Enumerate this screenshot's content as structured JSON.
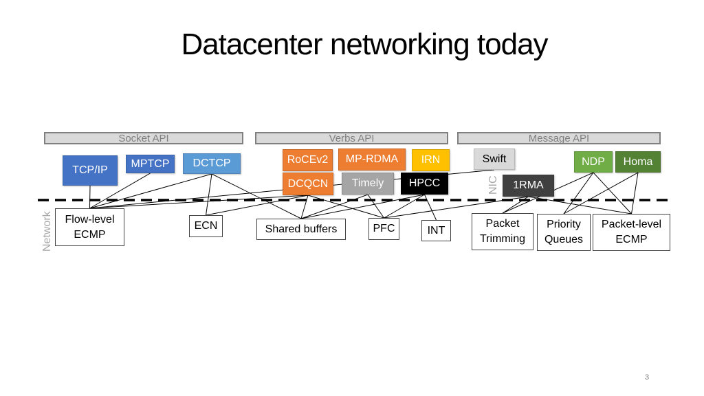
{
  "slide": {
    "title": "Datacenter networking today",
    "page_number": "3"
  },
  "apis": [
    {
      "id": "socket",
      "label": "Socket API"
    },
    {
      "id": "verbs",
      "label": "Verbs API"
    },
    {
      "id": "message",
      "label": "Message API"
    }
  ],
  "layer_labels": {
    "network": "Network",
    "nic": "NIC"
  },
  "host_protocols": [
    {
      "id": "tcpip",
      "label": "TCP/IP",
      "color": "#4472c4"
    },
    {
      "id": "mptcp",
      "label": "MPTCP",
      "color": "#4472c4"
    },
    {
      "id": "dctcp",
      "label": "DCTCP",
      "color": "#5b9bd5"
    },
    {
      "id": "rocev2",
      "label": "RoCEv2",
      "color": "#ed7d31"
    },
    {
      "id": "mprdma",
      "label": "MP-RDMA",
      "color": "#ed7d31"
    },
    {
      "id": "irn",
      "label": "IRN",
      "color": "#ffc000"
    },
    {
      "id": "dcqcn",
      "label": "DCQCN",
      "color": "#ed7d31"
    },
    {
      "id": "timely",
      "label": "Timely",
      "color": "#a5a5a5"
    },
    {
      "id": "hpcc",
      "label": "HPCC",
      "color": "#000000"
    },
    {
      "id": "swift",
      "label": "Swift",
      "color": "#d9d9d9"
    },
    {
      "id": "onerma",
      "label": "1RMA",
      "color": "#404040"
    },
    {
      "id": "ndp",
      "label": "NDP",
      "color": "#70ad47"
    },
    {
      "id": "homa",
      "label": "Homa",
      "color": "#548235"
    }
  ],
  "network_features": [
    {
      "id": "flowecmp",
      "label": "Flow-level ECMP"
    },
    {
      "id": "ecn",
      "label": "ECN"
    },
    {
      "id": "shared",
      "label": "Shared buffers"
    },
    {
      "id": "pfc",
      "label": "PFC"
    },
    {
      "id": "int",
      "label": "INT"
    },
    {
      "id": "trim",
      "label": "Packet Trimming"
    },
    {
      "id": "prio",
      "label": "Priority Queues"
    },
    {
      "id": "pktecmp",
      "label": "Packet-level ECMP"
    }
  ],
  "edges": [
    [
      "tcpip",
      "flowecmp"
    ],
    [
      "mptcp",
      "flowecmp"
    ],
    [
      "dctcp",
      "flowecmp"
    ],
    [
      "dctcp",
      "ecn"
    ],
    [
      "dctcp",
      "shared"
    ],
    [
      "dcqcn",
      "flowecmp"
    ],
    [
      "dcqcn",
      "ecn"
    ],
    [
      "dcqcn",
      "shared"
    ],
    [
      "dcqcn",
      "pfc"
    ],
    [
      "timely",
      "shared"
    ],
    [
      "timely",
      "pfc"
    ],
    [
      "hpcc",
      "shared"
    ],
    [
      "hpcc",
      "pfc"
    ],
    [
      "hpcc",
      "int"
    ],
    [
      "swift",
      "flowecmp"
    ],
    [
      "onerma",
      "pfc"
    ],
    [
      "onerma",
      "trim"
    ],
    [
      "onerma",
      "pktecmp"
    ],
    [
      "ndp",
      "trim"
    ],
    [
      "ndp",
      "prio"
    ],
    [
      "ndp",
      "pktecmp"
    ],
    [
      "homa",
      "prio"
    ],
    [
      "homa",
      "pktecmp"
    ]
  ]
}
